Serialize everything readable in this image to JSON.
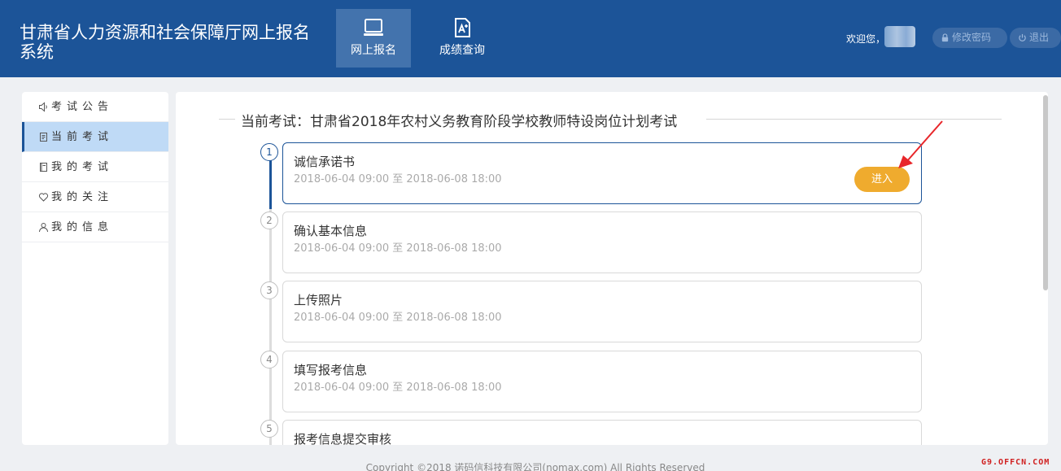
{
  "header": {
    "site_title": "甘肃省人力资源和社会保障厅网上报名系统",
    "nav": [
      {
        "label": "网上报名",
        "icon": "laptop-icon",
        "active": true
      },
      {
        "label": "成绩查询",
        "icon": "score-document-icon",
        "active": false
      }
    ],
    "welcome": "欢迎您，",
    "change_password": "修改密码",
    "logout": "退出"
  },
  "sidebar": {
    "items": [
      {
        "label": "考试公告",
        "icon": "speaker-icon",
        "active": false
      },
      {
        "label": "当前考试",
        "icon": "document-icon",
        "active": true
      },
      {
        "label": "我的考试",
        "icon": "book-icon",
        "active": false
      },
      {
        "label": "我的关注",
        "icon": "heart-icon",
        "active": false
      },
      {
        "label": "我的信息",
        "icon": "user-icon",
        "active": false
      }
    ]
  },
  "main": {
    "current_exam": "当前考试：甘肃省2018年农村义务教育阶段学校教师特设岗位计划考试",
    "steps": [
      {
        "num": "1",
        "title": "诚信承诺书",
        "time": "2018-06-04 09:00 至 2018-06-08 18:00",
        "active": true,
        "button": "进入"
      },
      {
        "num": "2",
        "title": "确认基本信息",
        "time": "2018-06-04 09:00 至 2018-06-08 18:00",
        "active": false
      },
      {
        "num": "3",
        "title": "上传照片",
        "time": "2018-06-04 09:00 至 2018-06-08 18:00",
        "active": false
      },
      {
        "num": "4",
        "title": "填写报考信息",
        "time": "2018-06-04 09:00 至 2018-06-08 18:00",
        "active": false
      },
      {
        "num": "5",
        "title": "报考信息提交审核",
        "time": "",
        "active": false
      }
    ]
  },
  "footer": {
    "copyright": "Copyright ©2018 诺码信科技有限公司(nomax.com) All Rights Reserved"
  },
  "watermark": "G9.OFFCN.COM",
  "colors": {
    "header_bg": "#1c5498",
    "accent_button": "#efab2e",
    "sidebar_active": "#bfdaf6"
  }
}
